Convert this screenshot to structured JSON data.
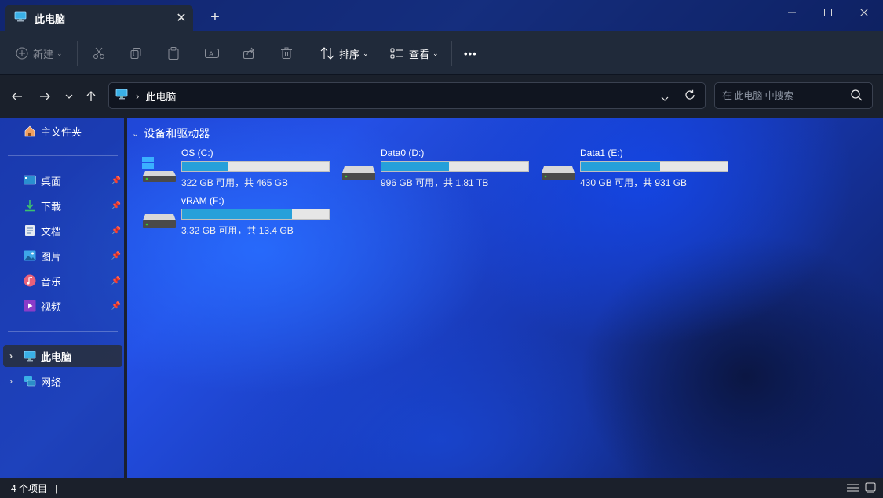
{
  "window": {
    "tab_title": "此电脑",
    "new_tab_icon": "plus-icon",
    "close_tab_icon": "close-icon",
    "controls": [
      "minimize-icon",
      "maximize-icon",
      "close-icon"
    ]
  },
  "toolbar": {
    "new_label": "新建",
    "sort_label": "排序",
    "view_label": "查看",
    "more_label": "•••",
    "disabled_icons": [
      "cut-icon",
      "copy-icon",
      "paste-icon",
      "rename-icon",
      "share-icon",
      "delete-icon"
    ]
  },
  "address": {
    "crumb": "此电脑",
    "search_placeholder": "在 此电脑 中搜索"
  },
  "sidebar": {
    "home": "主文件夹",
    "quick": [
      {
        "label": "桌面",
        "icon": "desktop-icon"
      },
      {
        "label": "下载",
        "icon": "download-icon"
      },
      {
        "label": "文档",
        "icon": "document-icon"
      },
      {
        "label": "图片",
        "icon": "picture-icon"
      },
      {
        "label": "音乐",
        "icon": "music-icon"
      },
      {
        "label": "视频",
        "icon": "video-icon"
      }
    ],
    "this_pc": "此电脑",
    "network": "网络"
  },
  "content": {
    "section_title": "设备和驱动器",
    "drives": [
      {
        "name": "OS (C:)",
        "free": "322 GB 可用，共 465 GB",
        "used_fraction": 0.31
      },
      {
        "name": "Data0 (D:)",
        "free": "996 GB 可用，共 1.81 TB",
        "used_fraction": 0.46
      },
      {
        "name": "Data1 (E:)",
        "free": "430 GB 可用，共 931 GB",
        "used_fraction": 0.54
      },
      {
        "name": "vRAM (F:)",
        "free": "3.32 GB 可用，共 13.4 GB",
        "used_fraction": 0.75
      }
    ]
  },
  "status": {
    "item_count": "4 个项目",
    "cursor": "|"
  },
  "colors": {
    "accent": "#26a0da",
    "chrome": "#202a3a"
  }
}
